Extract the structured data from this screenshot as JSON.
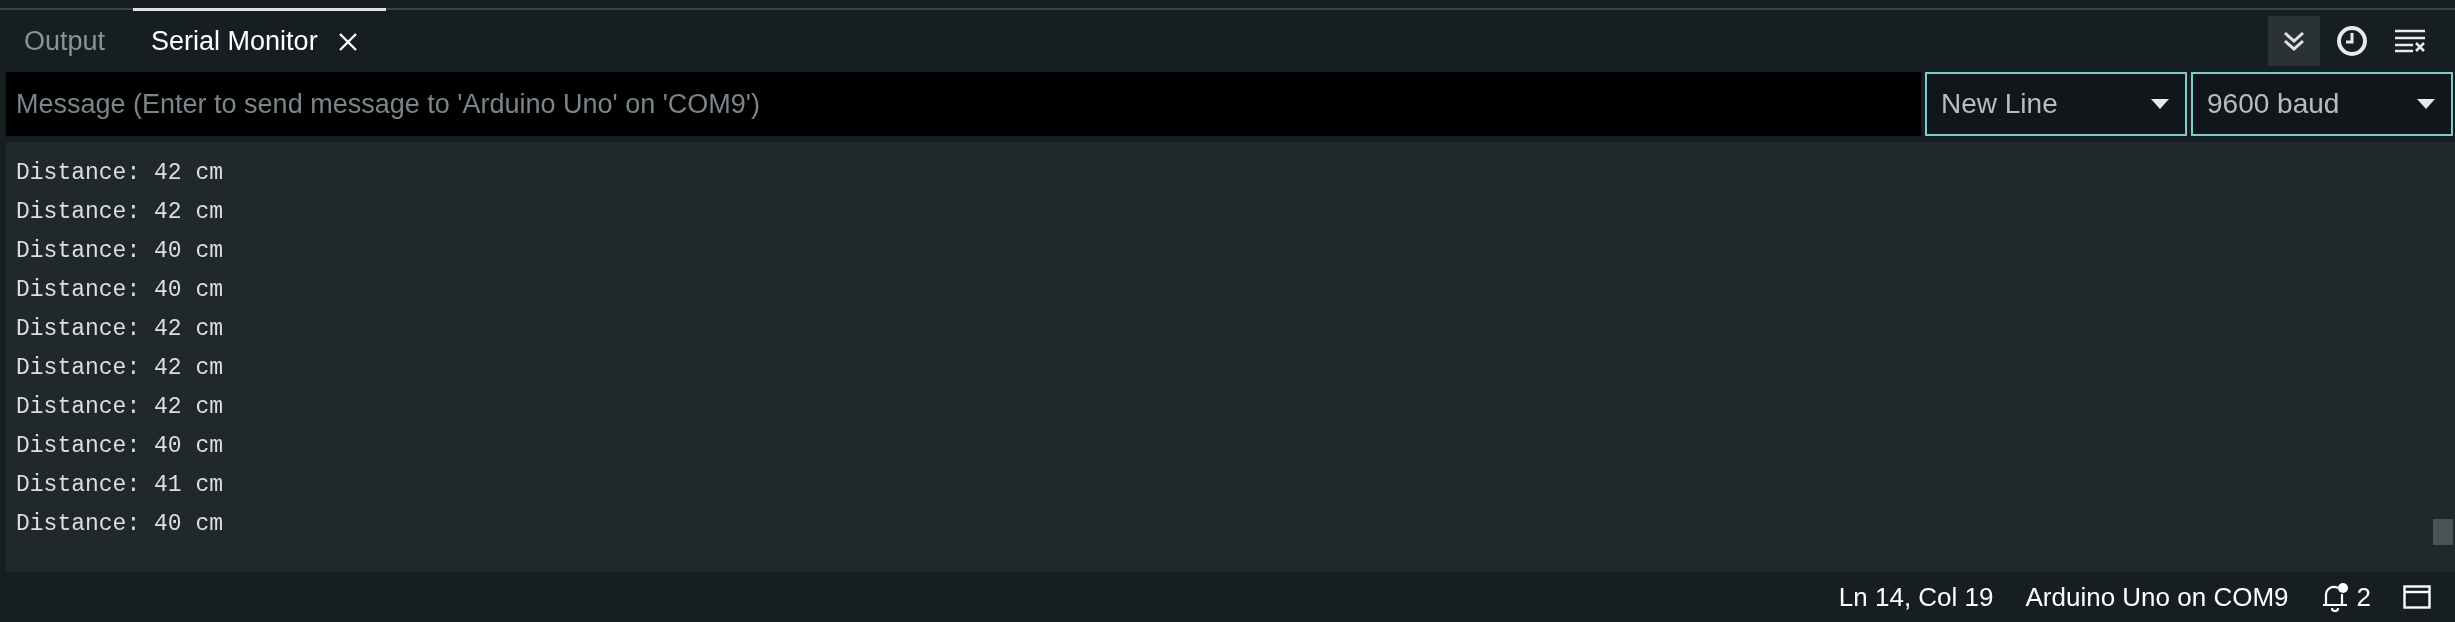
{
  "tabs": [
    {
      "label": "Output",
      "selected": false,
      "closable": false
    },
    {
      "label": "Serial Monitor",
      "selected": true,
      "closable": true
    }
  ],
  "toolbar": {
    "autoscroll_on": true
  },
  "message": {
    "placeholder": "Message (Enter to send message to 'Arduino Uno' on 'COM9')"
  },
  "line_ending": {
    "value": "New Line"
  },
  "baud_rate": {
    "value": "9600 baud"
  },
  "output_lines": [
    "Distance: 42 cm",
    "Distance: 42 cm",
    "Distance: 40 cm",
    "Distance: 40 cm",
    "Distance: 42 cm",
    "Distance: 42 cm",
    "Distance: 42 cm",
    "Distance: 40 cm",
    "Distance: 41 cm",
    "Distance: 40 cm"
  ],
  "status_bar": {
    "position": "Ln 14, Col 19",
    "board": "Arduino Uno on COM9",
    "notifications": "2"
  }
}
